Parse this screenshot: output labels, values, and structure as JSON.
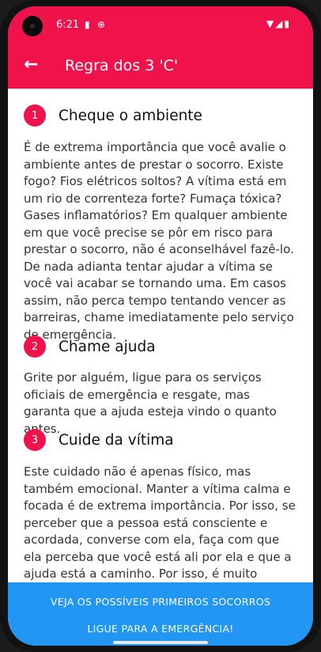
{
  "status_bar": {
    "time": "6:21",
    "left_icons": [
      "sd-card-icon",
      "vpn-icon"
    ],
    "right_icons": [
      "wifi-icon",
      "signal-icon",
      "battery-icon"
    ]
  },
  "app_bar": {
    "title": "Regra dos 3 'C'",
    "back_icon": "arrow-back-icon"
  },
  "sections": [
    {
      "number": "1",
      "title": "Cheque o ambiente",
      "text": "É de extrema importância que você avalie o ambiente antes de prestar o socorro. Existe fogo? Fios elétricos soltos? A vítima está em um rio de correnteza forte? Fumaça tóxica? Gases inflamatórios? Em qualquer ambiente em que você precise se pôr em risco para prestar o socorro, não é aconselhável fazê-lo. De nada adianta tentar ajudar a vítima se você vai acabar se tornando uma. Em casos assim, não perca tempo tentando vencer as barreiras, chame imediatamente pelo serviço de emergência."
    },
    {
      "number": "2",
      "title": "Chame ajuda",
      "text": "Grite por alguém, ligue para os serviços oficiais de emergência e resgate, mas garanta que a ajuda esteja vindo o quanto antes."
    },
    {
      "number": "3",
      "title": "Cuide da vítima",
      "text": "Este cuidado não é apenas físico, mas também emocional. Manter a vítima calma e focada é de extrema importância. Por isso, se perceber que a pessoa está consciente e acordada, converse com ela, faça com que ela perceba que você está ali por ela e que a ajuda está a caminho. Por isso, é muito importante que você também mantenha a calma. Não grite, permita"
    }
  ],
  "buttons": {
    "first_aid": "VEJA OS POSSÍVEIS PRIMEIROS SOCORROS",
    "emergency": "LIGUE PARA A EMERGÊNCIA!"
  },
  "colors": {
    "primary": "#f0124a",
    "accent": "#2196f3",
    "text": "#333333"
  }
}
